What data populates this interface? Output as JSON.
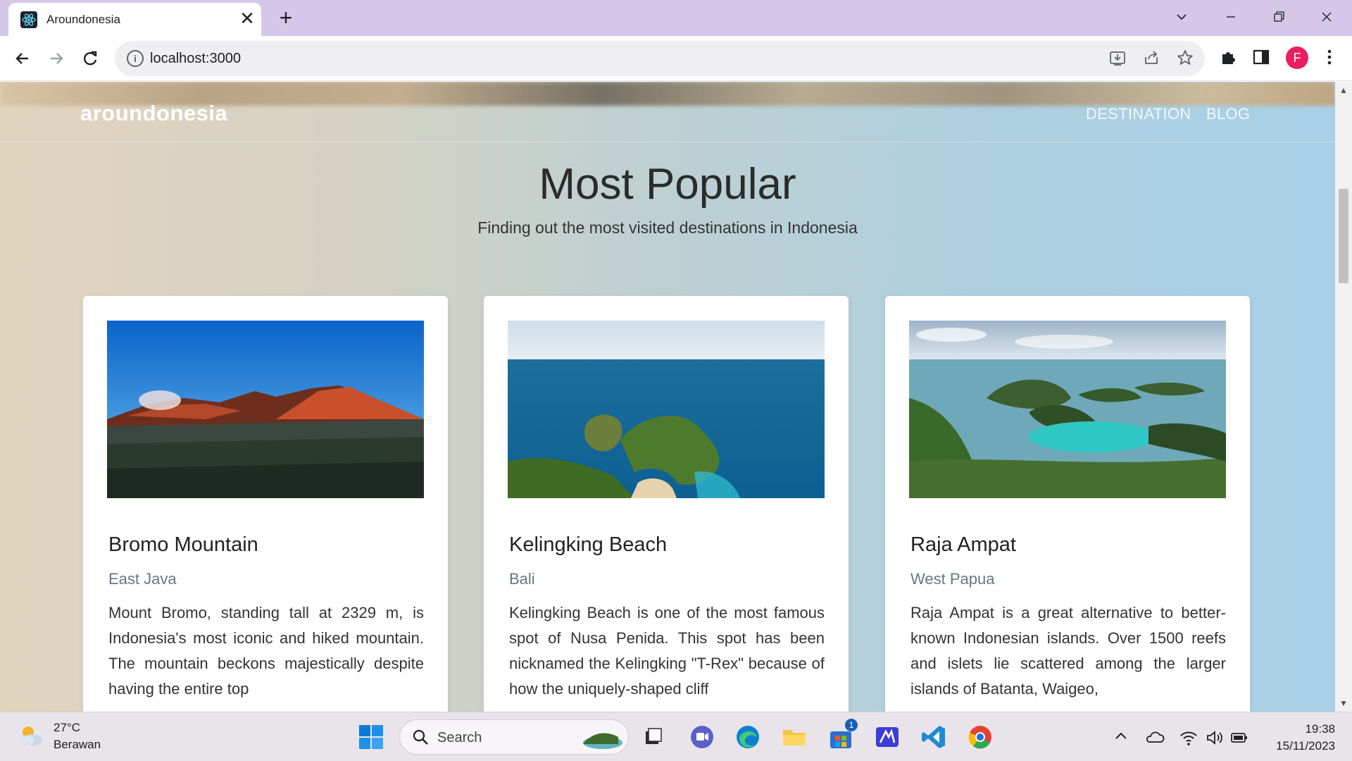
{
  "browser": {
    "tab_title": "Aroundonesia",
    "tab_close": "✕",
    "new_tab": "+",
    "url": "localhost:3000",
    "profile_initial": "F",
    "icons": [
      "react-favicon-icon",
      "back-icon",
      "forward-icon",
      "reload-icon",
      "info-icon",
      "install-icon",
      "share-icon",
      "star-icon",
      "extensions-icon",
      "sidepanel-icon",
      "menu-icon"
    ]
  },
  "site": {
    "brand": "aroundonesia",
    "nav": [
      "DESTINATION",
      "BLOG"
    ],
    "heading": "Most Popular",
    "subheading": "Finding out the most visited destinations in Indonesia"
  },
  "cards": [
    {
      "title": "Bromo Mountain",
      "region": "East Java",
      "description": "Mount Bromo, standing tall at 2329 m, is Indonesia's most iconic and hiked mountain. The mountain beckons majestically despite having the entire top"
    },
    {
      "title": "Kelingking Beach",
      "region": "Bali",
      "description": "Kelingking Beach is one of the most famous spot of Nusa Penida. This spot has been nicknamed the Kelingking \"T-Rex\" because of how the uniquely-shaped cliff"
    },
    {
      "title": "Raja Ampat",
      "region": "West Papua",
      "description": "Raja Ampat is a great alternative to better-known Indonesian islands. Over 1500 reefs and islets lie scattered among the larger islands of Batanta, Waigeo,"
    }
  ],
  "taskbar": {
    "weather_temp": "27°C",
    "weather_desc": "Berawan",
    "search_label": "Search",
    "store_badge": "1",
    "clock_time": "19:38",
    "clock_date": "15/11/2023"
  },
  "colors": {
    "tabbar": "#d4c7ea",
    "profile": "#e91e63",
    "heading": "#2b2b2b"
  }
}
